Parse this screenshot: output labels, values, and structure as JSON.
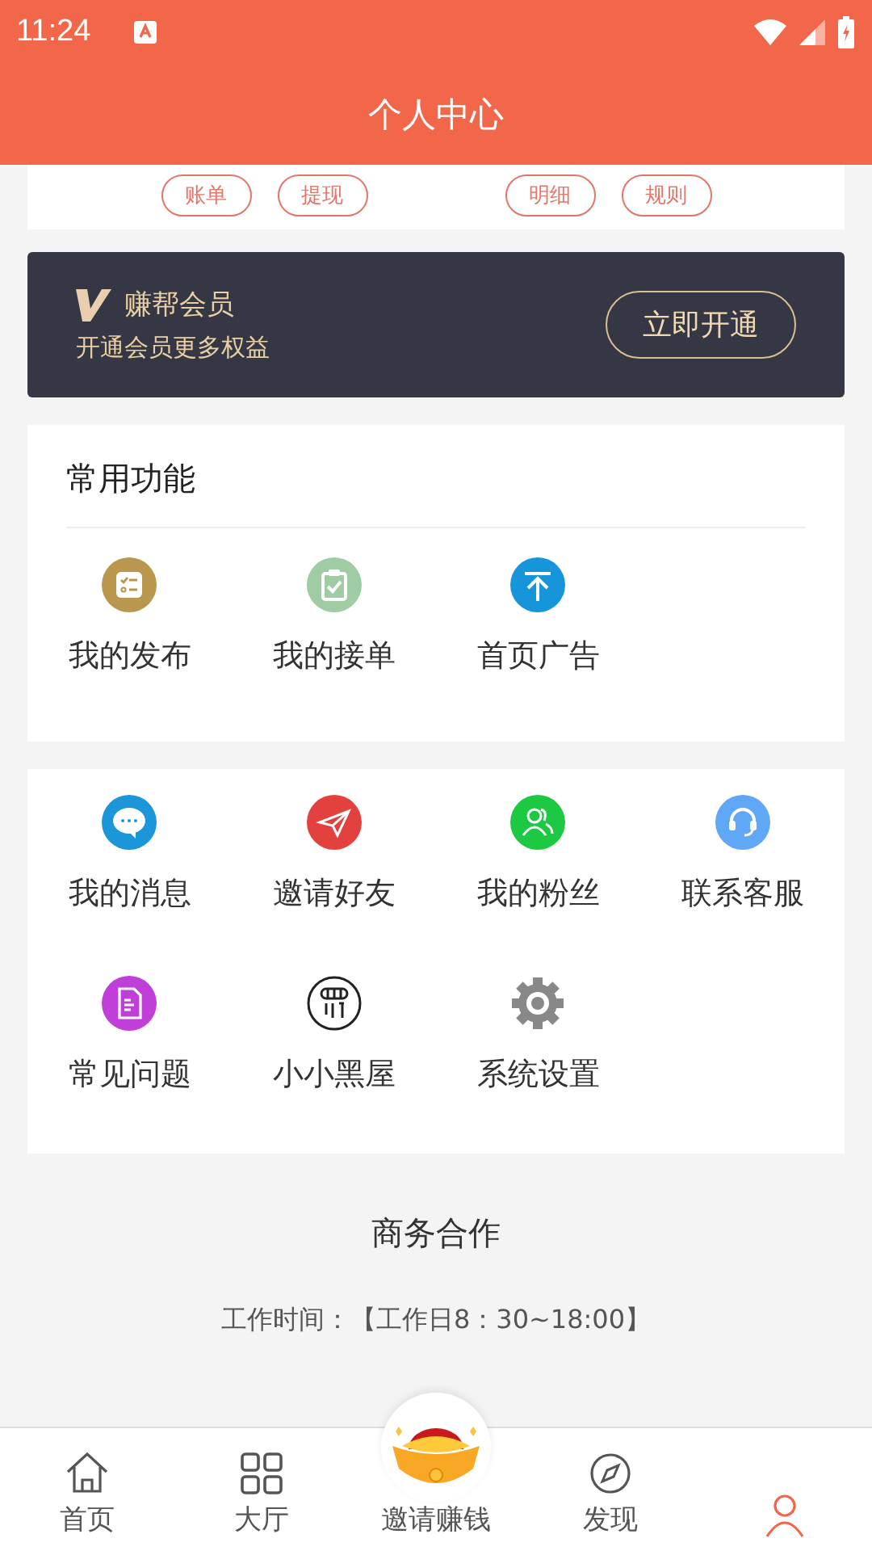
{
  "status_bar": {
    "time": "11:24"
  },
  "header": {
    "title": "个人中心"
  },
  "wallet_actions": [
    "账单",
    "提现",
    "明细",
    "规则"
  ],
  "vip": {
    "title": "赚帮会员",
    "subtitle": "开通会员更多权益",
    "button": "立即开通"
  },
  "common": {
    "title": "常用功能",
    "items": [
      {
        "label": "我的发布",
        "kind": "list",
        "color": "#b9974f"
      },
      {
        "label": "我的接单",
        "kind": "clipboard",
        "color": "#9fcca3"
      },
      {
        "label": "首页广告",
        "kind": "top",
        "color": "#1695db"
      }
    ]
  },
  "tools": [
    {
      "label": "我的消息",
      "kind": "chat",
      "color": "#1b96d8"
    },
    {
      "label": "邀请好友",
      "kind": "plane",
      "color": "#e2413d"
    },
    {
      "label": "我的粉丝",
      "kind": "people",
      "color": "#1dc843"
    },
    {
      "label": "联系客服",
      "kind": "headset",
      "color": "#60a8f6"
    },
    {
      "label": "常见问题",
      "kind": "doc",
      "color": "#c03fd8"
    },
    {
      "label": "小小黑屋",
      "kind": "jail",
      "color": "#222222"
    },
    {
      "label": "系统设置",
      "kind": "gear",
      "color": "#888888"
    }
  ],
  "business": {
    "title": "商务合作",
    "hours": "工作时间：【工作日8：30~18:00】"
  },
  "tabs": [
    {
      "label": "首页",
      "kind": "home",
      "selected": false
    },
    {
      "label": "大厅",
      "kind": "grid",
      "selected": false
    },
    {
      "label": "邀请赚钱",
      "kind": "ingot",
      "selected": false
    },
    {
      "label": "发现",
      "kind": "compass",
      "selected": false
    },
    {
      "kind": "person",
      "selected": true
    }
  ]
}
